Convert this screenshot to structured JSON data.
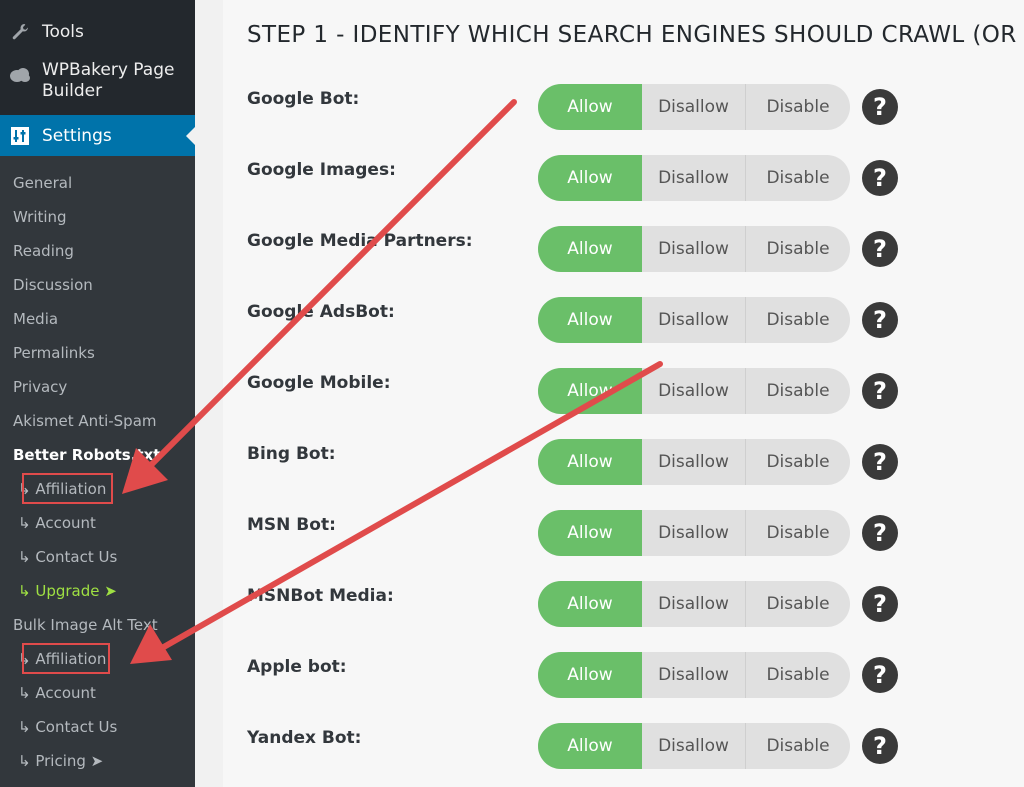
{
  "sidebar": {
    "tools": "Tools",
    "wpbakery": "WPBakery Page Builder",
    "settings": "Settings",
    "items": [
      {
        "label": "General"
      },
      {
        "label": "Writing"
      },
      {
        "label": "Reading"
      },
      {
        "label": "Discussion"
      },
      {
        "label": "Media"
      },
      {
        "label": "Permalinks"
      },
      {
        "label": "Privacy"
      },
      {
        "label": "Akismet Anti-Spam"
      },
      {
        "label": "Better Robots.txt"
      },
      {
        "label": "↳ Affiliation"
      },
      {
        "label": "↳ Account"
      },
      {
        "label": "↳ Contact Us"
      },
      {
        "label": "↳ Upgrade ➤"
      },
      {
        "label": "Bulk Image Alt Text"
      },
      {
        "label": "↳ Affiliation"
      },
      {
        "label": "↳ Account"
      },
      {
        "label": "↳ Contact Us"
      },
      {
        "label": "↳ Pricing ➤"
      }
    ]
  },
  "main": {
    "heading": "STEP 1 - IDENTIFY WHICH SEARCH ENGINES SHOULD CRAWL (OR",
    "toggle_labels": {
      "allow": "Allow",
      "disallow": "Disallow",
      "disable": "Disable"
    },
    "help_label": "?",
    "bots": [
      {
        "label": "Google Bot:",
        "selected": "Allow"
      },
      {
        "label": "Google Images:",
        "selected": "Allow"
      },
      {
        "label": "Google Media Partners:",
        "selected": "Allow"
      },
      {
        "label": "Google AdsBot:",
        "selected": "Allow"
      },
      {
        "label": "Google Mobile:",
        "selected": "Allow"
      },
      {
        "label": "Bing Bot:",
        "selected": "Allow"
      },
      {
        "label": "MSN Bot:",
        "selected": "Allow"
      },
      {
        "label": "MSNBot Media:",
        "selected": "Allow"
      },
      {
        "label": "Apple bot:",
        "selected": "Allow"
      },
      {
        "label": "Yandex Bot:",
        "selected": "Allow"
      }
    ]
  },
  "colors": {
    "sidebar_bg": "#23282d",
    "submenu_bg": "#32373c",
    "active_blue": "#0073aa",
    "allow_green": "#6abf69",
    "upgrade_green": "#9fe043",
    "annotation_red": "#e04b4b"
  }
}
